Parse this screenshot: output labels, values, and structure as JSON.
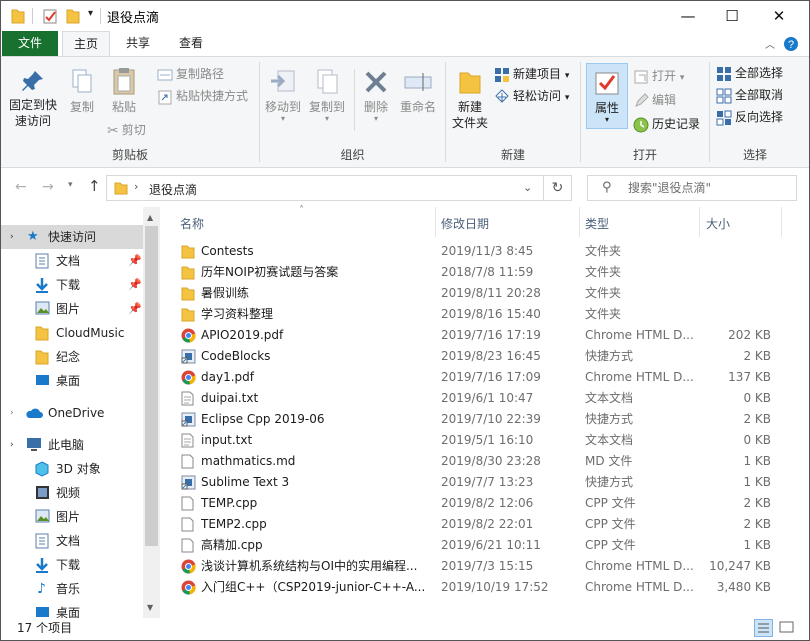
{
  "window": {
    "title": "退役点滴",
    "minimize": "—",
    "maximize": "☐",
    "close": "✕",
    "dropdown": "▾"
  },
  "tabs": [
    {
      "label": "文件"
    },
    {
      "label": "主页"
    },
    {
      "label": "共享"
    },
    {
      "label": "查看"
    }
  ],
  "ribbon": {
    "groups": {
      "clipboard": "剪贴板",
      "organize": "组织",
      "new": "新建",
      "open": "打开",
      "select": "选择"
    },
    "pin_quick_access": [
      "固定到快",
      "速访问"
    ],
    "copy": "复制",
    "paste": "粘贴",
    "copy_path": "复制路径",
    "paste_shortcut": "粘贴快捷方式",
    "cut": "剪切",
    "move_to": "移动到",
    "copy_to": "复制到",
    "delete": "删除",
    "rename": "重命名",
    "new_folder": [
      "新建",
      "文件夹"
    ],
    "new_item": "新建项目",
    "easy_access": "轻松访问",
    "properties": "属性",
    "open": "打开",
    "edit": "编辑",
    "history": "历史记录",
    "select_all": "全部选择",
    "select_none": "全部取消",
    "invert_selection": "反向选择"
  },
  "address": {
    "path": "退役点滴",
    "search_placeholder": "搜索\"退役点滴\""
  },
  "nav": {
    "quick_access": "快速访问",
    "items": [
      {
        "label": "文档",
        "pinned": true
      },
      {
        "label": "下载",
        "pinned": true
      },
      {
        "label": "图片",
        "pinned": true
      },
      {
        "label": "CloudMusic",
        "pinned": false
      },
      {
        "label": "纪念",
        "pinned": false
      },
      {
        "label": "桌面",
        "pinned": false
      }
    ],
    "onedrive": "OneDrive",
    "this_pc": "此电脑",
    "pc_items": [
      {
        "label": "3D 对象"
      },
      {
        "label": "视频"
      },
      {
        "label": "图片"
      },
      {
        "label": "文档"
      },
      {
        "label": "下载"
      },
      {
        "label": "音乐"
      },
      {
        "label": "桌面"
      }
    ]
  },
  "columns": {
    "name": "名称",
    "date": "修改日期",
    "type": "类型",
    "size": "大小"
  },
  "files": [
    {
      "name": "Contests",
      "date": "2019/11/3 8:45",
      "type": "文件夹",
      "size": "",
      "icon": "folder-icon"
    },
    {
      "name": "历年NOIP初赛试题与答案",
      "date": "2018/7/8 11:59",
      "type": "文件夹",
      "size": "",
      "icon": "folder-icon"
    },
    {
      "name": "暑假训练",
      "date": "2019/8/11 20:28",
      "type": "文件夹",
      "size": "",
      "icon": "folder-icon"
    },
    {
      "name": "学习资料整理",
      "date": "2019/8/16 15:40",
      "type": "文件夹",
      "size": "",
      "icon": "folder-icon"
    },
    {
      "name": "APIO2019.pdf",
      "date": "2019/7/16 17:19",
      "type": "Chrome HTML D...",
      "size": "202 KB",
      "icon": "chrome-icon"
    },
    {
      "name": "CodeBlocks",
      "date": "2019/8/23 16:45",
      "type": "快捷方式",
      "size": "2 KB",
      "icon": "shortcut-icon"
    },
    {
      "name": "day1.pdf",
      "date": "2019/7/16 17:09",
      "type": "Chrome HTML D...",
      "size": "137 KB",
      "icon": "chrome-icon"
    },
    {
      "name": "duipai.txt",
      "date": "2019/6/1 10:47",
      "type": "文本文档",
      "size": "0 KB",
      "icon": "text-file-icon"
    },
    {
      "name": "Eclipse Cpp 2019-06",
      "date": "2019/7/10 22:39",
      "type": "快捷方式",
      "size": "2 KB",
      "icon": "shortcut-icon"
    },
    {
      "name": "input.txt",
      "date": "2019/5/1 16:10",
      "type": "文本文档",
      "size": "0 KB",
      "icon": "text-file-icon"
    },
    {
      "name": "mathmatics.md",
      "date": "2019/8/30 23:28",
      "type": "MD 文件",
      "size": "1 KB",
      "icon": "file-icon"
    },
    {
      "name": "Sublime Text 3",
      "date": "2019/7/7 13:23",
      "type": "快捷方式",
      "size": "1 KB",
      "icon": "shortcut-icon"
    },
    {
      "name": "TEMP.cpp",
      "date": "2019/8/2 12:06",
      "type": "CPP 文件",
      "size": "2 KB",
      "icon": "file-icon"
    },
    {
      "name": "TEMP2.cpp",
      "date": "2019/8/2 22:01",
      "type": "CPP 文件",
      "size": "2 KB",
      "icon": "file-icon"
    },
    {
      "name": "高精加.cpp",
      "date": "2019/6/21 10:11",
      "type": "CPP 文件",
      "size": "1 KB",
      "icon": "file-icon"
    },
    {
      "name": "浅谈计算机系统结构与OI中的实用编程...",
      "date": "2019/7/3 15:15",
      "type": "Chrome HTML D...",
      "size": "10,247 KB",
      "icon": "chrome-icon"
    },
    {
      "name": "入门组C++（CSP2019-junior-C++-A...",
      "date": "2019/10/19 17:52",
      "type": "Chrome HTML D...",
      "size": "3,480 KB",
      "icon": "chrome-icon"
    }
  ],
  "status": {
    "count": "17 个项目"
  },
  "colors": {
    "file_tab": "#19712f",
    "folder": "#f5c342",
    "accent": "#1979ca",
    "selected": "#cce8ff"
  }
}
